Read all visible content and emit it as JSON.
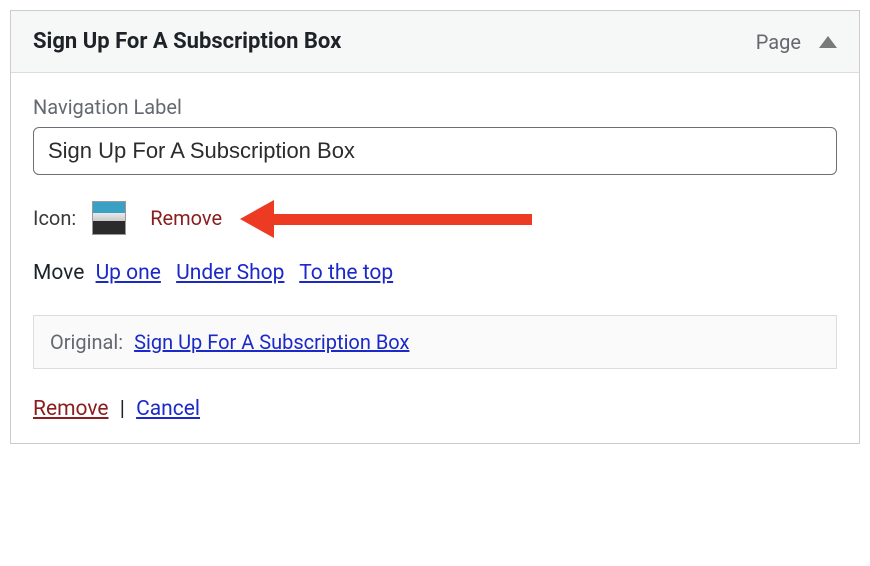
{
  "header": {
    "title": "Sign Up For A Subscription Box",
    "type_label": "Page"
  },
  "nav_label": {
    "label": "Navigation Label",
    "value": "Sign Up For A Subscription Box"
  },
  "icon_row": {
    "label": "Icon:",
    "remove": "Remove"
  },
  "move": {
    "label": "Move",
    "up_one": "Up one",
    "under_shop": "Under Shop",
    "to_top": "To the top"
  },
  "original": {
    "label": "Original:",
    "link": "Sign Up For A Subscription Box"
  },
  "footer": {
    "remove": "Remove",
    "separator": "|",
    "cancel": "Cancel"
  }
}
